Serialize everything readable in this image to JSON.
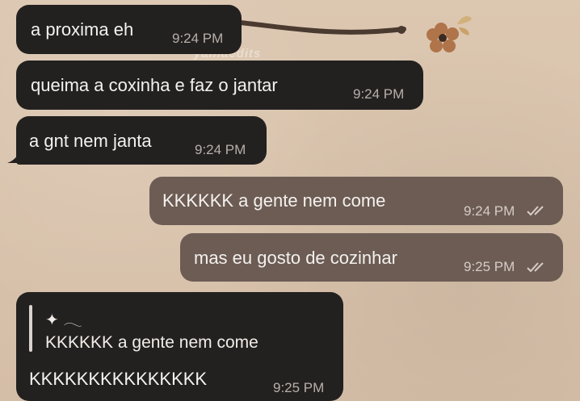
{
  "watermark": "yaniaedits",
  "colors": {
    "background": "#d8c3ad",
    "incoming_bubble": "#232120",
    "outgoing_bubble": "#6c5c54",
    "message_text": "#f4f1ee",
    "timestamp": "#b7afaa"
  },
  "messages": [
    {
      "direction": "incoming",
      "text": "a proxima eh",
      "time": "9:24 PM"
    },
    {
      "direction": "incoming",
      "text": "queima a coxinha e faz o jantar",
      "time": "9:24 PM"
    },
    {
      "direction": "incoming",
      "text": "a gnt nem janta",
      "time": "9:24 PM"
    },
    {
      "direction": "outgoing",
      "text": "KKKKKK a gente nem come",
      "time": "9:24 PM",
      "status": "read-double-check"
    },
    {
      "direction": "outgoing",
      "text": "mas eu gosto de cozinhar",
      "time": "9:25 PM",
      "status": "read-double-check"
    },
    {
      "direction": "incoming",
      "reply_to": {
        "name": "✦ 𓂃",
        "text": "KKKKKK a gente nem come"
      },
      "text": "KKKKKKKKKKKKKKK",
      "time": "9:25 PM"
    }
  ]
}
